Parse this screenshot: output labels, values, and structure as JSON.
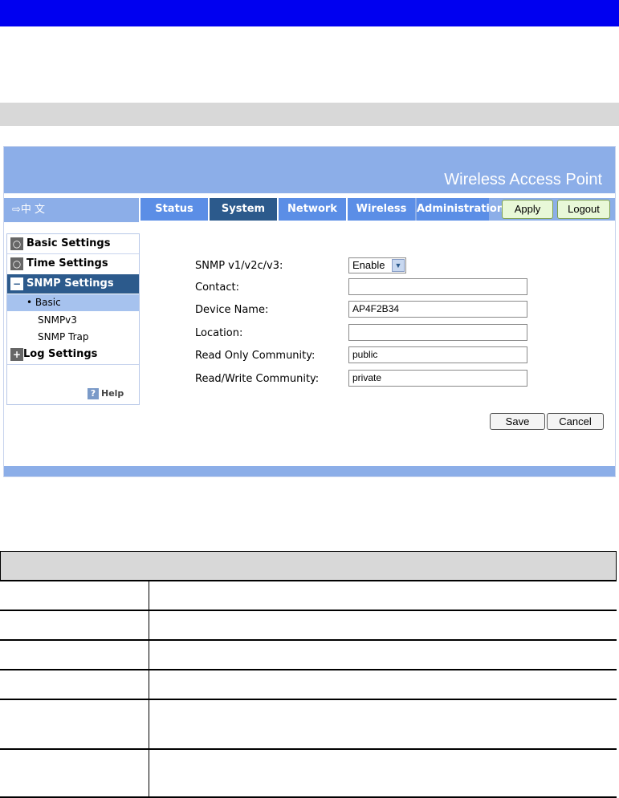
{
  "banner": {
    "title": "Wireless Access Point"
  },
  "language": {
    "label": "⇨中 文"
  },
  "tabs": [
    {
      "label": "Status"
    },
    {
      "label": "System"
    },
    {
      "label": "Network"
    },
    {
      "label": "Wireless"
    },
    {
      "label": "Administration"
    }
  ],
  "header_buttons": {
    "apply": "Apply",
    "logout": "Logout"
  },
  "sidebar": {
    "basic_settings": "Basic Settings",
    "time_settings": "Time Settings",
    "snmp_settings": "SNMP Settings",
    "sub_basic": "• Basic",
    "sub_snmpv3": "SNMPv3",
    "sub_snmp_trap": "SNMP Trap",
    "log_settings": "Log Settings",
    "help": "Help"
  },
  "form": {
    "snmp_label": "SNMP v1/v2c/v3:",
    "snmp_value": "Enable",
    "contact_label": "Contact:",
    "contact_value": "",
    "device_name_label": "Device Name:",
    "device_name_value": "AP4F2B34",
    "location_label": "Location:",
    "location_value": "",
    "ro_community_label": "Read Only Community:",
    "ro_community_value": "public",
    "rw_community_label": "Read/Write Community:",
    "rw_community_value": "private",
    "save": "Save",
    "cancel": "Cancel"
  },
  "colors": {
    "top_bar": "#0000f0",
    "banner": "#8caee8",
    "active_tab": "#2c5a8c",
    "tab": "#5b8ee6"
  }
}
